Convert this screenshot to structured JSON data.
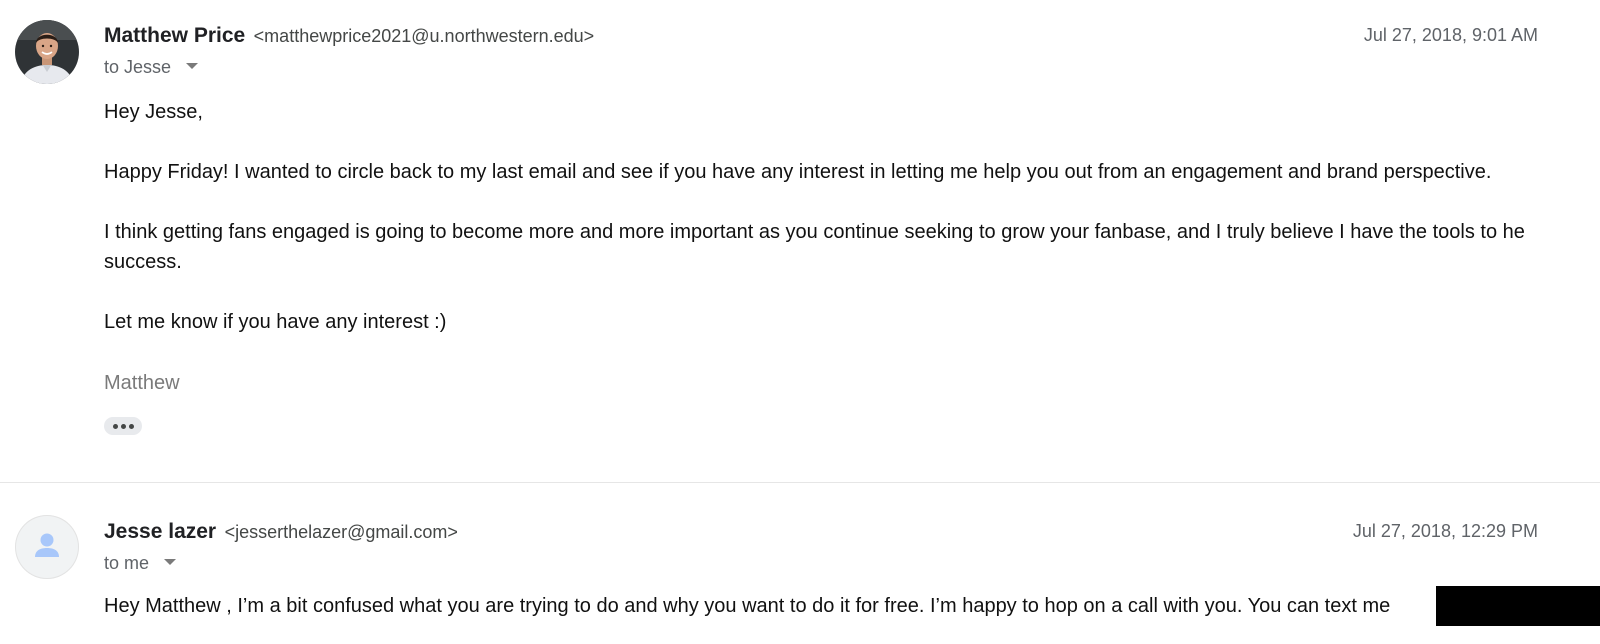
{
  "messages": [
    {
      "sender_name": "Matthew Price",
      "sender_email": "<matthewprice2021@u.northwestern.edu>",
      "recipient": "to Jesse",
      "date": "Jul 27, 2018, 9:01 AM",
      "avatar_icon": "profile-photo",
      "body": {
        "greeting": "Hey Jesse,",
        "para1": "Happy Friday! I wanted to circle back to my last email and see if you have any interest in letting me help you out from an engagement and brand perspective.",
        "para2_line1": "I think getting fans engaged is going to become more and more important as you continue seeking to grow your fanbase, and I truly believe I have the tools to he",
        "para2_line2": "success.",
        "para3": "Let me know if you have any interest :)",
        "signature": "Matthew"
      },
      "show_trimmed_icon": "ellipsis-icon"
    },
    {
      "sender_name": "Jesse lazer",
      "sender_email": "<jesserthelazer@gmail.com>",
      "recipient": "to me",
      "date": "Jul 27, 2018, 12:29 PM",
      "avatar_icon": "default-person-icon",
      "body": {
        "line1": "Hey Matthew , I’m a bit confused what you are trying to do and why you want to do it for free. I’m happy to hop on a call with you. You can text me"
      }
    }
  ],
  "colors": {
    "divider": "#e6e6e6",
    "secondary_text": "#5f6368",
    "redaction": "#000000",
    "placeholder_avatar": "#a8c7fa"
  }
}
